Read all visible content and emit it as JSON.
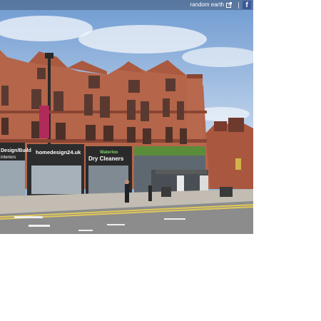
{
  "viewer": {
    "brand_label": "random earth",
    "external_link_icon": "external-link-icon",
    "share_icon": "facebook-icon",
    "share_glyph": "f"
  },
  "storefronts": {
    "left_sign": "Design/Build",
    "left_sign_sub": "interiors",
    "home_sign": "homedesign24.uk",
    "dry_cleaners_top": "Waterloo",
    "dry_cleaners": "Dry Cleaners"
  },
  "colors": {
    "sky": "#9fbce0",
    "brick": "#b5654a",
    "brick_dark": "#8a4533",
    "road": "#8c8c8c",
    "facebook": "#3b5998"
  }
}
